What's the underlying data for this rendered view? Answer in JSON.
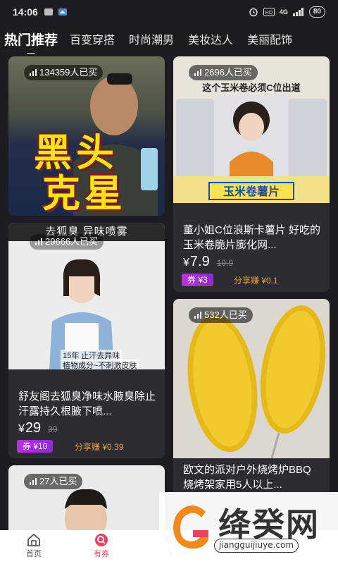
{
  "status_bar": {
    "time": "14:06",
    "network": "4G",
    "battery": "80"
  },
  "tabs": [
    "热门推荐",
    "百变穿搭",
    "时尚潮男",
    "美妆达人",
    "美丽配饰"
  ],
  "cards": [
    {
      "buyers": "134359人已买",
      "image_text": [
        "黑头",
        "克星"
      ]
    },
    {
      "buyers": "2696人已买",
      "image_banner": "这个玉米卷必须C位出道",
      "image_tag": "玉米卷薯片",
      "title": "董小姐C位浪斯卡薯片 好吃的玉米卷脆片膨化网...",
      "price": "7.9",
      "original_price": "10.9",
      "coupon": "券 ¥3",
      "share": "分享赚 ¥0.1"
    },
    {
      "buyers": "29666人已买",
      "image_banner": "去狐臭 异味喷雾",
      "image_caption1": "15年 止汗去异味",
      "image_caption2": "植物成分~不刺激皮肤",
      "title": "舒友阁去狐臭净味水腋臭除止汗露持久根腋下喷...",
      "price": "29",
      "original_price": "39",
      "coupon": "券 ¥10",
      "share": "分享赚 ¥0.39"
    },
    {
      "buyers": "532人已买",
      "title": "欧文的派对户外烧烤炉BBQ烧烤架家用5人以上..."
    },
    {
      "buyers": "27人已买"
    }
  ],
  "yen": "¥",
  "bottom_nav": [
    "首页",
    "有券",
    "骑"
  ],
  "watermark": {
    "name": "绛癸网",
    "url": "jiangguijiuye.com"
  }
}
